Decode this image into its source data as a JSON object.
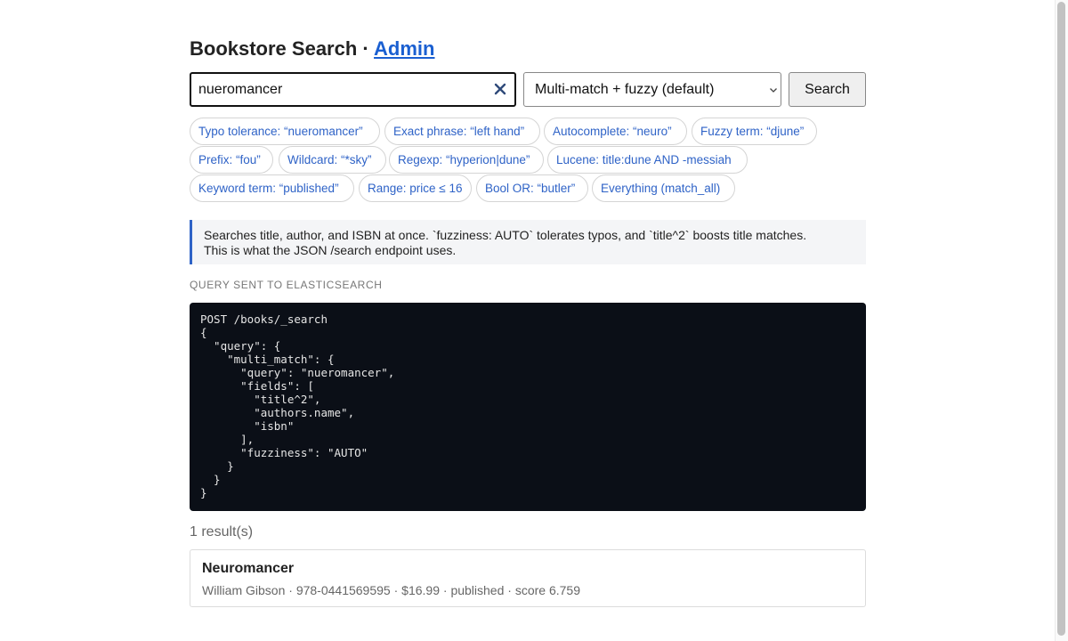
{
  "header": {
    "title": "Bookstore Search",
    "separator": "·",
    "admin_link": "Admin"
  },
  "search": {
    "value": "nueromancer",
    "clear_icon": "close-icon"
  },
  "mode_select": {
    "selected": "Multi-match + fuzzy (default)",
    "chevron_icon": "chevron-down-icon"
  },
  "search_button": "Search",
  "examples": {
    "row1": [
      "Typo tolerance: “nueromancer”",
      "Exact phrase: “left hand”",
      "Autocomplete: “neuro”",
      "Fuzzy term: “djune”"
    ],
    "row2": [
      "Prefix: “fou”",
      "Wildcard: “*sky”",
      "Regexp: “hyperion|dune”",
      "Lucene: title:dune AND -messiah"
    ],
    "row3": [
      "Keyword term: “published”",
      "Range: price ≤ 16",
      "Bool OR: “butler”",
      "Everything (match_all)"
    ]
  },
  "note": {
    "line1": "Searches title, author, and ISBN at once. `fuzziness: AUTO` tolerates typos, and `title^2` boosts title matches.",
    "line2": "This is what the JSON /search endpoint uses."
  },
  "query_label": "QUERY SENT TO ELASTICSEARCH",
  "query_code": "POST /books/_search\n{\n  \"query\": {\n    \"multi_match\": {\n      \"query\": \"nueromancer\",\n      \"fields\": [\n        \"title^2\",\n        \"authors.name\",\n        \"isbn\"\n      ],\n      \"fuzziness\": \"AUTO\"\n    }\n  }\n}",
  "results": {
    "count_text": "1 result(s)",
    "items": [
      {
        "title": "Neuromancer",
        "author": "William Gibson",
        "isbn": "978-0441569595",
        "price": "$16.99",
        "status": "published",
        "score": "score 6.759"
      }
    ]
  },
  "colors": {
    "accent": "#2f63c7",
    "link": "#1a5fd1",
    "code_bg": "#0b0f17"
  }
}
